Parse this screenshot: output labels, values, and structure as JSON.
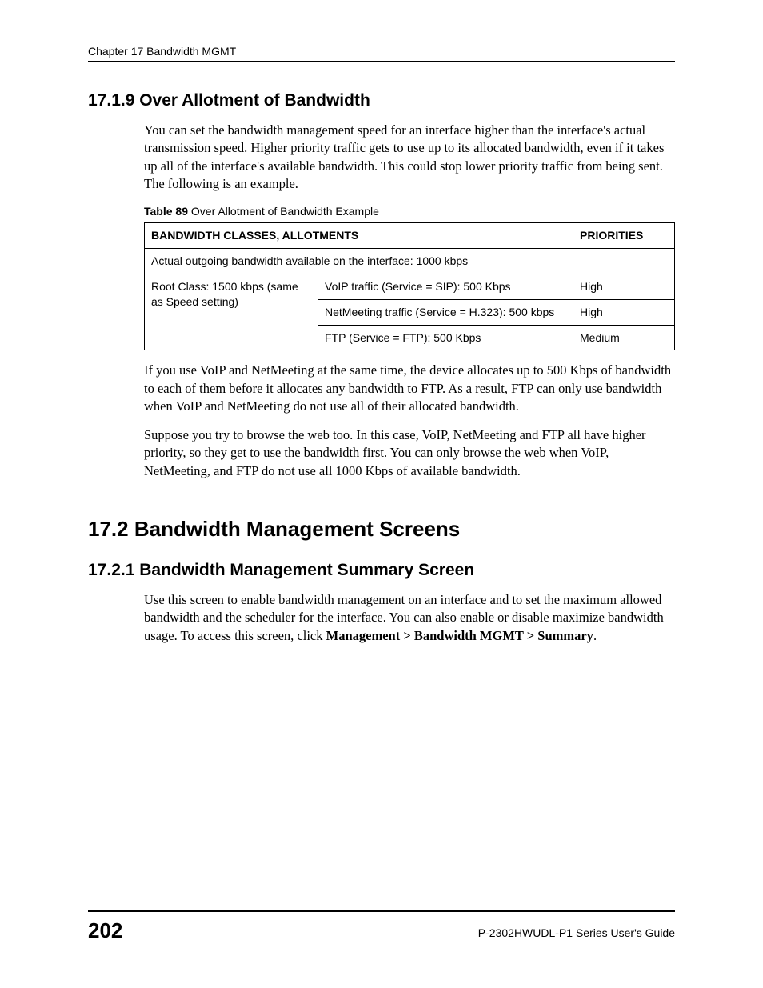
{
  "runningHead": "Chapter 17 Bandwidth MGMT",
  "section_17_1_9": {
    "heading": "17.1.9  Over Allotment of Bandwidth",
    "p1": "You can set the bandwidth management speed for an interface higher than the interface's actual transmission speed. Higher priority traffic gets to use up to its allocated bandwidth, even if it takes up all of the interface's available bandwidth. This could stop lower priority traffic from being sent. The following is an example.",
    "tableCaptionBold": "Table 89",
    "tableCaptionRest": "   Over Allotment of Bandwidth Example",
    "colHeader1": "BANDWIDTH CLASSES, ALLOTMENTS",
    "colHeader2": "PRIORITIES",
    "row_actual": "Actual outgoing bandwidth available on the interface: 1000 kbps",
    "rootClass": "Root Class: 1500 kbps  (same as Speed setting)",
    "voip": "VoIP traffic (Service = SIP): 500 Kbps",
    "voipPriority": "High",
    "netmeeting": "NetMeeting traffic (Service = H.323): 500 kbps",
    "netmeetingPriority": "High",
    "ftp": "FTP (Service = FTP): 500 Kbps",
    "ftpPriority": "Medium",
    "p2": "If you use VoIP and NetMeeting at the same time, the device allocates up to 500 Kbps of bandwidth to each of them before it allocates any bandwidth to FTP. As a result, FTP can only use bandwidth when VoIP and NetMeeting do not use all of their allocated bandwidth.",
    "p3": "Suppose you try to browse the web too. In this case, VoIP, NetMeeting and FTP all have higher priority, so they get to use the bandwidth first. You can only browse the web when VoIP, NetMeeting, and FTP do not use all 1000 Kbps of available bandwidth."
  },
  "section_17_2": {
    "heading": "17.2  Bandwidth Management Screens"
  },
  "section_17_2_1": {
    "heading": "17.2.1  Bandwidth Management Summary Screen",
    "p1_a": "Use this screen to enable bandwidth management on an interface and to set the maximum allowed bandwidth and the scheduler for the interface. You can also enable or disable maximize bandwidth usage. To access this screen, click ",
    "p1_b": "Management > Bandwidth MGMT > Summary",
    "p1_c": "."
  },
  "footer": {
    "pageNumber": "202",
    "guide": "P-2302HWUDL-P1 Series User's Guide"
  }
}
